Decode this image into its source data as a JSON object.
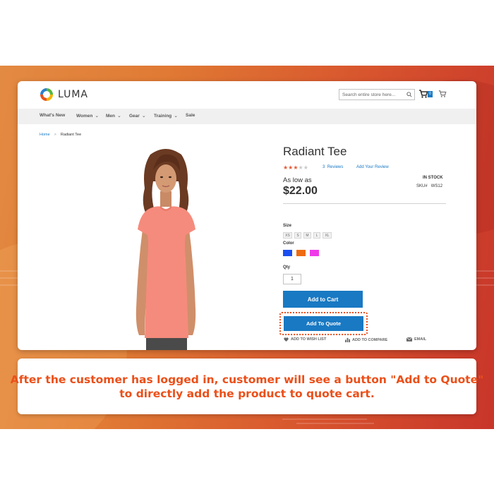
{
  "site": {
    "logo_text": "LUMA",
    "search_placeholder": "Search entire store here...",
    "quote_cart_count": "0"
  },
  "nav": {
    "items": [
      {
        "label": "What's New",
        "has_dropdown": false
      },
      {
        "label": "Women",
        "has_dropdown": true
      },
      {
        "label": "Men",
        "has_dropdown": true
      },
      {
        "label": "Gear",
        "has_dropdown": true
      },
      {
        "label": "Training",
        "has_dropdown": true
      },
      {
        "label": "Sale",
        "has_dropdown": false
      }
    ]
  },
  "breadcrumb": {
    "home": "Home",
    "separator": ">",
    "current": "Radiant Tee"
  },
  "product": {
    "title": "Radiant Tee",
    "rating_stars": 3,
    "rating_max": 5,
    "reviews_count": "3",
    "reviews_label": "Reviews",
    "add_review_label": "Add Your Review",
    "price_prefix": "As low as",
    "price": "$22.00",
    "stock": "IN STOCK",
    "sku_label": "SKU#",
    "sku_value": "WS12",
    "size_label": "Size",
    "sizes": [
      "XS",
      "S",
      "M",
      "L",
      "XL"
    ],
    "color_label": "Color",
    "colors": [
      "#1b4ef0",
      "#ee6b12",
      "#ef3ae9"
    ],
    "qty_label": "Qty",
    "qty_value": "1",
    "add_to_cart_label": "Add to Cart",
    "add_to_quote_label": "Add To Quote",
    "actions": {
      "wishlist": "ADD TO WISH LIST",
      "compare": "ADD TO COMPARE",
      "email": "EMAIL"
    }
  },
  "colors": {
    "primary": "#1979c3",
    "highlight": "#ec4f18",
    "star": "#e55a35"
  },
  "caption": {
    "line1": "After the customer has logged in, customer will see a button \"Add to Quote\"",
    "line2": "to directly add the product to quote cart."
  }
}
